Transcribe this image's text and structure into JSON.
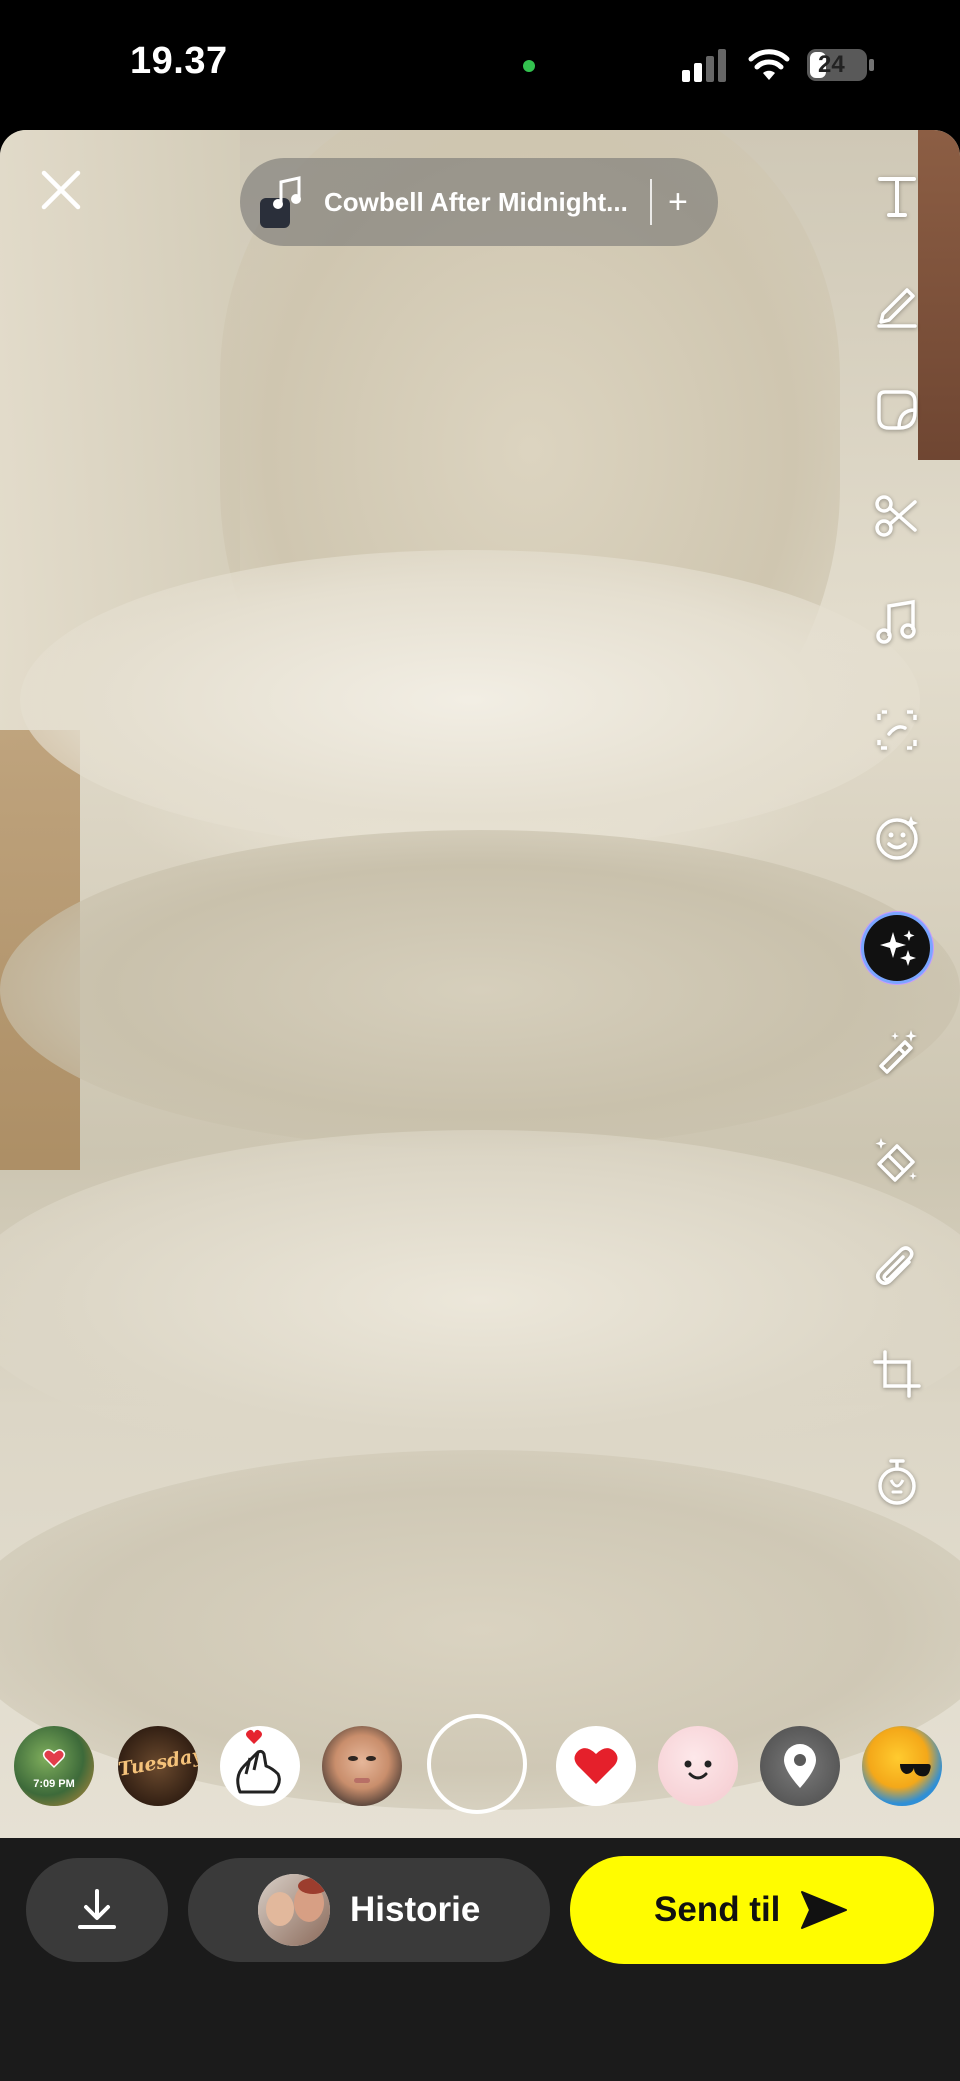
{
  "status_bar": {
    "time": "19.37",
    "battery_level": "24",
    "camera_indicator_color": "#33c24f"
  },
  "music": {
    "title": "Cowbell After Midnight...",
    "add_label": "+"
  },
  "toolbar": {
    "icons": [
      "text-icon",
      "pencil-icon",
      "sticker-icon",
      "scissors-icon",
      "music-note-icon",
      "scan-icon",
      "lens-face-icon",
      "ai-sparkles-icon",
      "magic-wand-icon",
      "eraser-icon",
      "paperclip-icon",
      "crop-icon",
      "timer-icon"
    ]
  },
  "lenses": {
    "items": [
      {
        "name": "lens-time-sticker",
        "label": "7:09 PM"
      },
      {
        "name": "lens-tuesday",
        "label": "Tuesday"
      },
      {
        "name": "lens-heart-hand",
        "label": ""
      },
      {
        "name": "lens-face-portrait",
        "label": ""
      },
      {
        "name": "lens-heart",
        "label": ""
      },
      {
        "name": "lens-smiley",
        "label": ""
      },
      {
        "name": "lens-location",
        "label": ""
      },
      {
        "name": "lens-sun-sunglasses",
        "label": ""
      }
    ]
  },
  "bottom_bar": {
    "story_label": "Historie",
    "send_label": "Send til",
    "send_color": "#fffc00"
  }
}
